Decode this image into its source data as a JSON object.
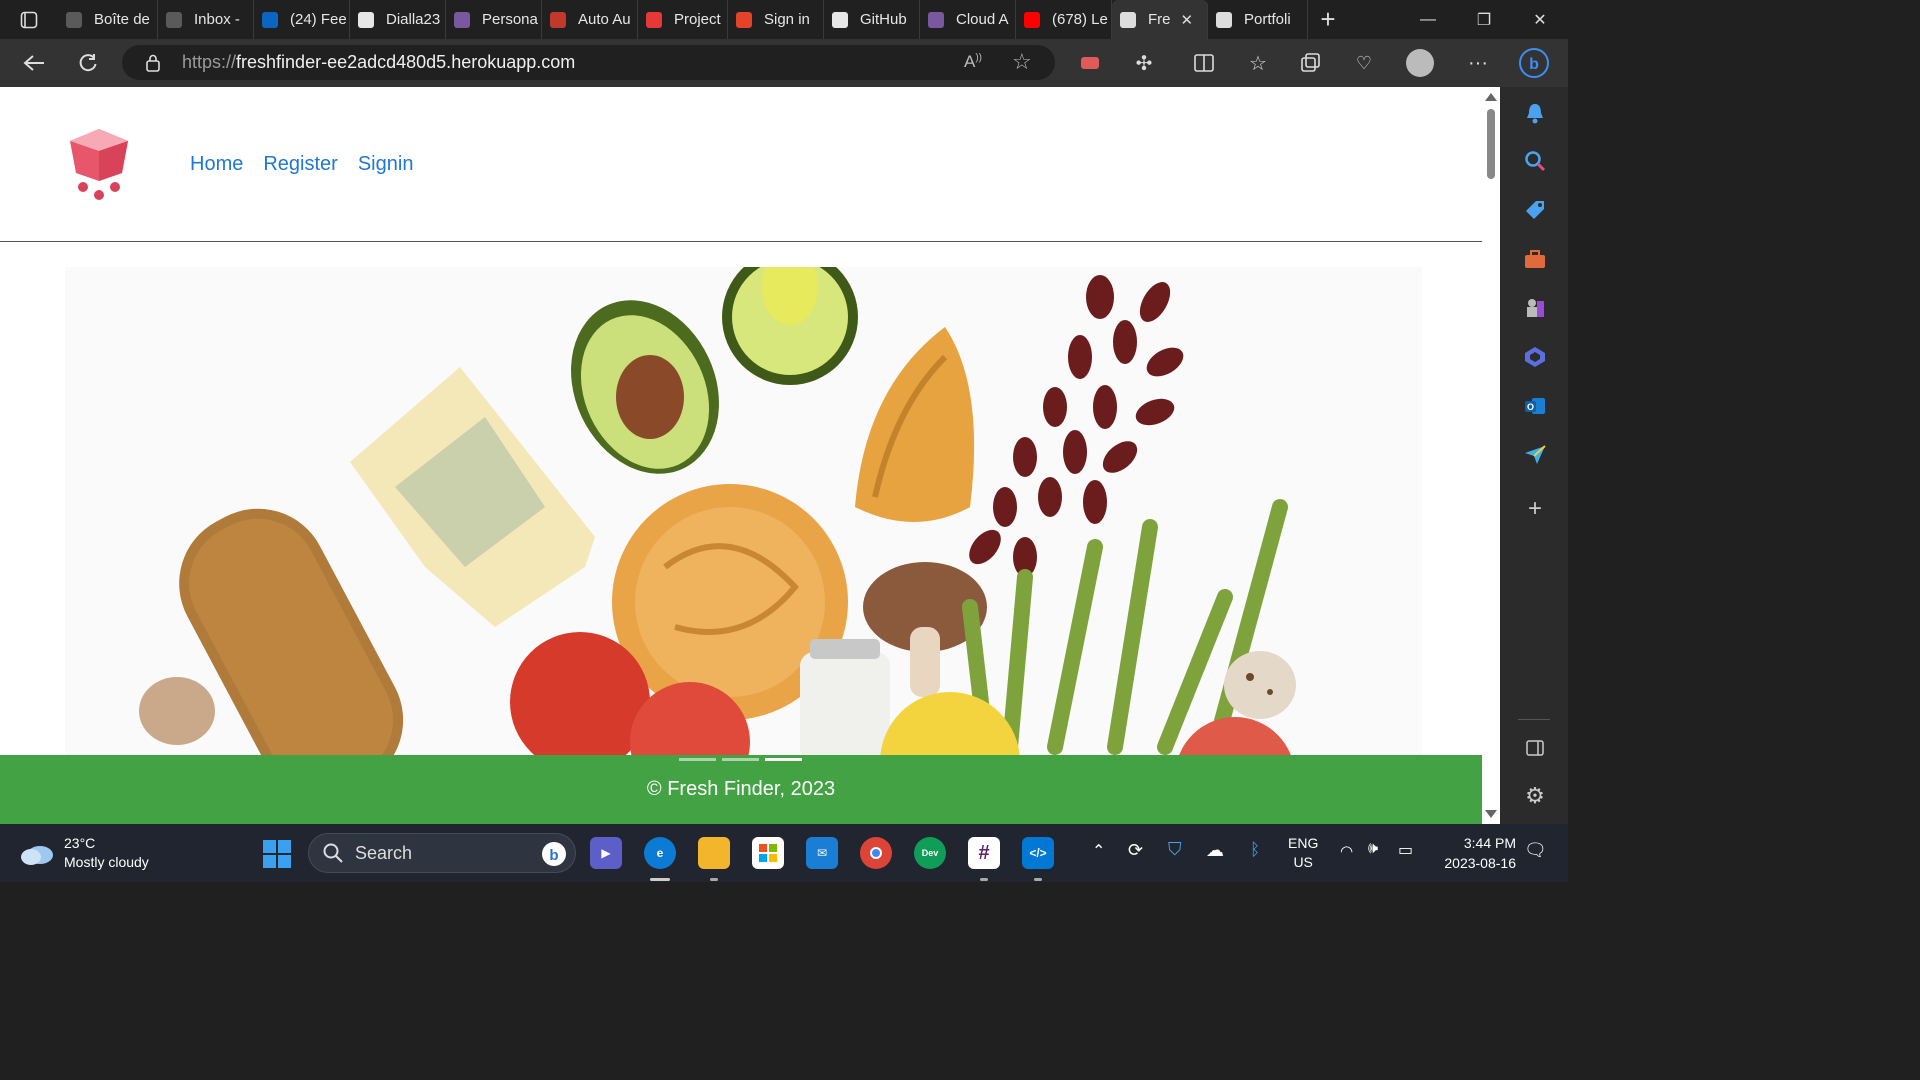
{
  "browser": {
    "tabs": [
      {
        "label": "Boîte de",
        "icon": "gmail-icon",
        "color": "#5a5a5a"
      },
      {
        "label": "Inbox -",
        "icon": "gmail-icon",
        "color": "#5a5a5a"
      },
      {
        "label": "(24) Fee",
        "icon": "linkedin-icon",
        "color": "#0a66c2"
      },
      {
        "label": "Dialla23",
        "icon": "github-icon",
        "color": "#e6e6e6"
      },
      {
        "label": "Persona",
        "icon": "heroku-icon",
        "color": "#79589f"
      },
      {
        "label": "Auto Au",
        "icon": "auto-icon",
        "color": "#c0392b"
      },
      {
        "label": "Project",
        "icon": "project-icon",
        "color": "#e53935"
      },
      {
        "label": "Sign in",
        "icon": "gitlab-icon",
        "color": "#e24329"
      },
      {
        "label": "GitHub",
        "icon": "github-icon",
        "color": "#e6e6e6"
      },
      {
        "label": "Cloud A",
        "icon": "heroku-icon",
        "color": "#79589f"
      },
      {
        "label": "(678) Le",
        "icon": "youtube-icon",
        "color": "#ff0000"
      },
      {
        "label": "Fre",
        "icon": "page-icon",
        "color": "#ddd",
        "active": true
      },
      {
        "label": "Portfoli",
        "icon": "page-icon",
        "color": "#ddd"
      }
    ],
    "url_scheme": "https://",
    "url_host": "freshfinder-ee2adcd480d5.herokuapp.com"
  },
  "page": {
    "nav": [
      "Home",
      "Register",
      "Signin"
    ],
    "footer_text": "© Fresh Finder, 2023",
    "carousel_active_index": 2
  },
  "taskbar": {
    "weather_temp": "23°C",
    "weather_desc": "Mostly cloudy",
    "search_label": "Search",
    "lang_top": "ENG",
    "lang_bottom": "US",
    "time": "3:44 PM",
    "date": "2023-08-16"
  }
}
